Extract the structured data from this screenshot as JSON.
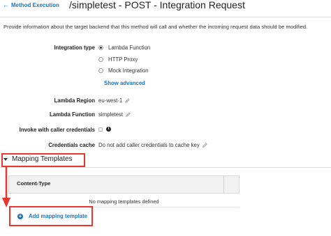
{
  "header": {
    "back_label": "Method Execution",
    "title": "/simpletest - POST - Integration Request"
  },
  "description": "Provide information about the target backend that this method will call and whether the incoming request data should be modified.",
  "integration": {
    "label": "Integration type",
    "options": [
      {
        "label": "Lambda Function",
        "selected": true
      },
      {
        "label": "HTTP Proxy",
        "selected": false
      },
      {
        "label": "Mock Integration",
        "selected": false
      }
    ],
    "show_advanced": "Show advanced"
  },
  "lambda_region": {
    "label": "Lambda Region",
    "value": "eu-west-1"
  },
  "lambda_function": {
    "label": "Lambda Function",
    "value": "simpletest"
  },
  "invoke_caller": {
    "label": "Invoke with caller credentials",
    "checked": false
  },
  "credentials_cache": {
    "label": "Credentials cache",
    "value": "Do not add caller credentials to cache key"
  },
  "mapping_templates": {
    "title": "Mapping Templates",
    "column_header": "Content-Type",
    "empty_text": "No mapping templates defined",
    "add_label": "Add mapping template"
  },
  "colors": {
    "link": "#1a73b8",
    "highlight": "#e8372e"
  }
}
